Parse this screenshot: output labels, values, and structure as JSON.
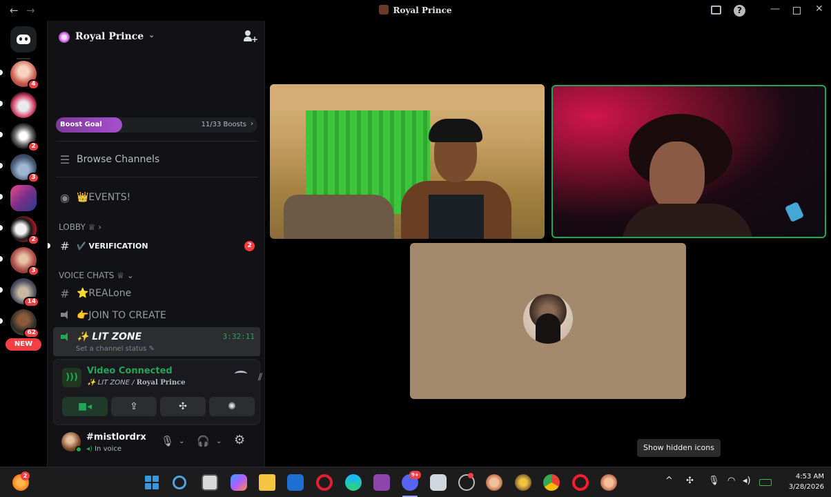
{
  "window": {
    "title": "Royal Prince",
    "back_glyph": "←",
    "forward_glyph": "→",
    "help_glyph": "?",
    "minimize_glyph": "—",
    "close_glyph": "✕"
  },
  "server_rail": {
    "home_icon": "discord-logo-icon",
    "servers": [
      {
        "badge": "4"
      },
      {
        "badge": ""
      },
      {
        "badge": "2"
      },
      {
        "badge": "3"
      },
      {
        "badge": ""
      },
      {
        "badge": "2"
      },
      {
        "badge": "3"
      },
      {
        "badge": "14"
      },
      {
        "badge": "62"
      }
    ],
    "new_badge": "NEW"
  },
  "server": {
    "name": "Royal Prince",
    "chevron": "⌄",
    "boost_goal": {
      "label": "Boost Goal",
      "count": "11/33 Boosts",
      "arrow": "›",
      "progress": 0.33
    }
  },
  "channels": {
    "browse": "Browse Channels",
    "events": "👑EVENTS!",
    "lobby_category": "LOBBY ♕ ›",
    "verification": "✔️ VERIFICATION",
    "verification_badge": "2",
    "voice_category": "VOICE CHATS ♕ ⌄",
    "realone": "⭐REALone",
    "join_to_create": "👉JOIN TO CREATE",
    "lit_zone": "✨ LIT ZONE",
    "lit_zone_timer": "3:32:11",
    "lit_zone_status": "Set a channel status ✎"
  },
  "voice_panel": {
    "status": "Video Connected",
    "channel": "✨ LIT ZONE / ",
    "server": "Royal Prince"
  },
  "user": {
    "name": "#mistlordrx",
    "status": "In voice"
  },
  "stage": {
    "tooltip": "Show hidden icons"
  },
  "taskbar": {
    "weather_badge": "2",
    "discord_badge": "9+",
    "tray_chevron": "^",
    "time": "4:53 AM",
    "date": "3/28/2026"
  },
  "colors": {
    "accent_green": "#23a55a",
    "mention_red": "#f23f43",
    "boost_purple": "#a64fcf"
  }
}
